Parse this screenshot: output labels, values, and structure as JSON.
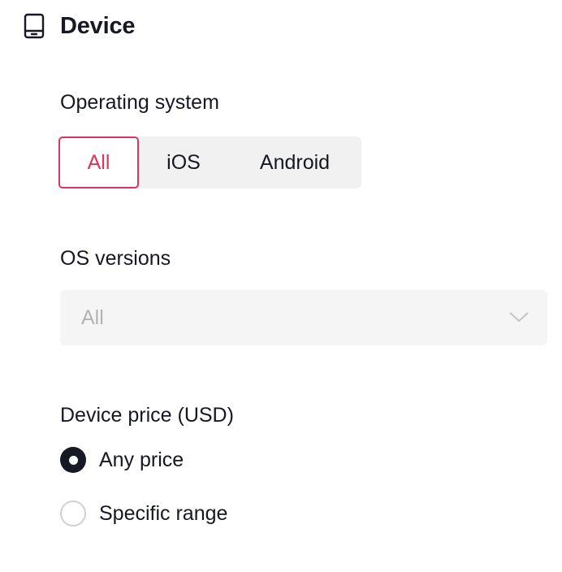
{
  "section": {
    "title": "Device",
    "icon": "device-icon"
  },
  "operating_system": {
    "label": "Operating system",
    "options": [
      "All",
      "iOS",
      "Android"
    ],
    "selected": "All",
    "accent_color": "#e0335a"
  },
  "os_versions": {
    "label": "OS versions",
    "value": "All",
    "icon": "chevron-down-icon"
  },
  "device_price": {
    "label": "Device price (USD)",
    "options": [
      {
        "label": "Any price",
        "checked": true
      },
      {
        "label": "Specific range",
        "checked": false
      }
    ]
  }
}
